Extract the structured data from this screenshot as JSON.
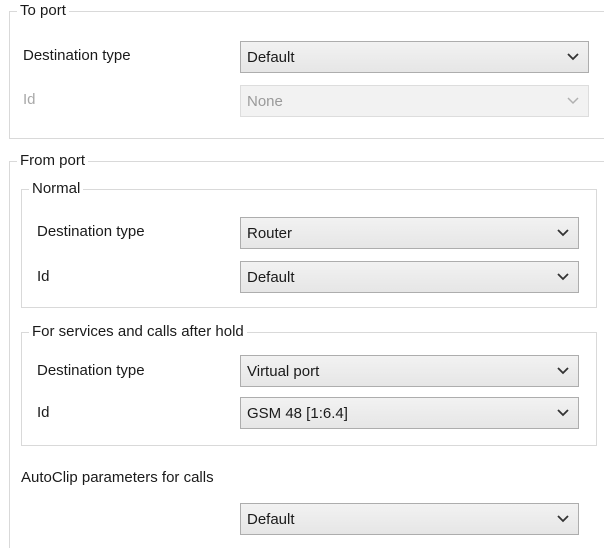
{
  "to_port": {
    "legend": "To port",
    "destination_type": {
      "label": "Destination type",
      "value": "Default"
    },
    "id": {
      "label": "Id",
      "value": "None"
    }
  },
  "from_port": {
    "legend": "From port",
    "normal": {
      "legend": "Normal",
      "destination_type": {
        "label": "Destination type",
        "value": "Router"
      },
      "id": {
        "label": "Id",
        "value": "Default"
      }
    },
    "services": {
      "legend": "For services and calls after hold",
      "destination_type": {
        "label": "Destination type",
        "value": "Virtual port"
      },
      "id": {
        "label": "Id",
        "value": "GSM 48 [1:6.4]"
      }
    },
    "autoclip": {
      "label": "AutoClip parameters for calls",
      "value": "Default"
    }
  },
  "icons": {
    "dropdown": "chevron-down-icon"
  },
  "colors": {
    "group_border": "#d9d9d9",
    "combo_border": "#adadad",
    "disabled_text": "#a8a8a8"
  }
}
